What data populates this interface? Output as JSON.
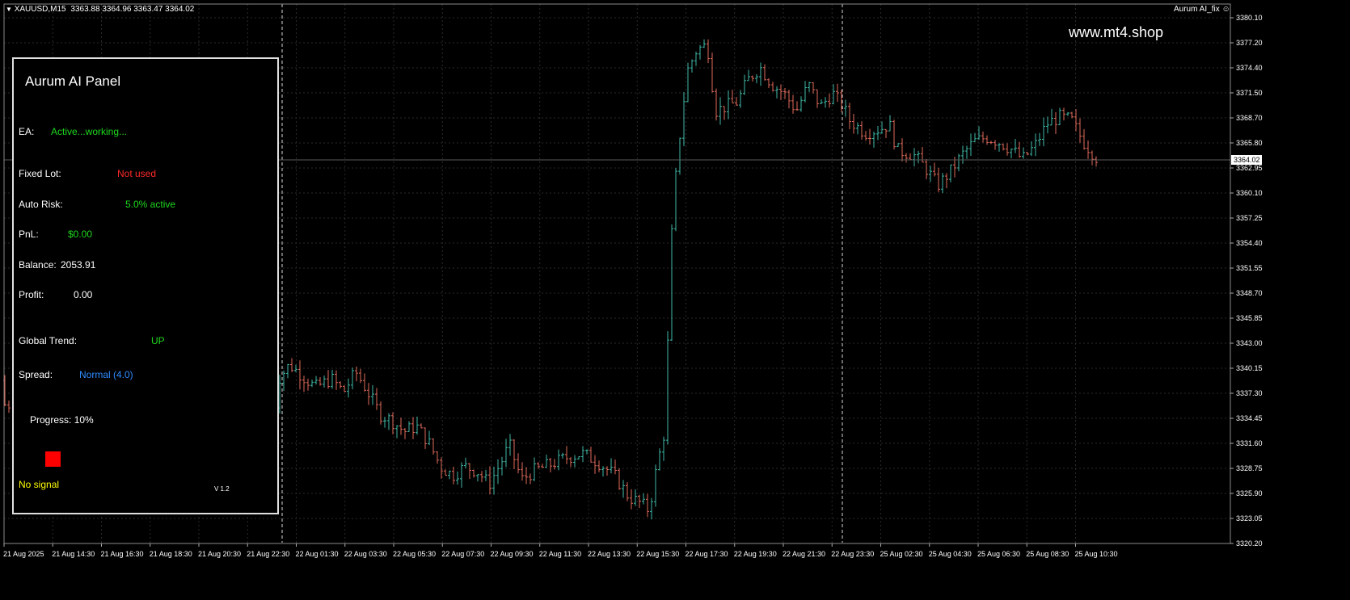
{
  "window": {
    "symbol_label": "XAUUSD,M15",
    "ohlc": "3363.88 3364.96 3363.47 3364.02",
    "indicator_label": "Aurum AI_fix",
    "watermark": "www.mt4.shop"
  },
  "panel": {
    "title": "Aurum AI Panel",
    "ea_label": "EA:",
    "ea_value": "Active...working...",
    "fixed_lot_label": "Fixed Lot:",
    "fixed_lot_value": "Not used",
    "auto_risk_label": "Auto Risk:",
    "auto_risk_value": "5.0% active",
    "pnl_label": "PnL:",
    "pnl_value": "$0.00",
    "balance_label": "Balance:",
    "balance_value": "2053.91",
    "profit_label": "Profit:",
    "profit_value": "0.00",
    "global_trend_label": "Global Trend:",
    "global_trend_value": "UP",
    "spread_label": "Spread:",
    "spread_value": "Normal (4.0)",
    "progress_label": "Progress:",
    "progress_value": "10%",
    "signal_text": "No signal",
    "version": "V 1.2",
    "colors": {
      "green": "#1ed81e",
      "red": "#ff2a2a",
      "blue": "#2f8bff",
      "yellow": "#ffff00",
      "signal_square": "#ff0000"
    }
  },
  "price_axis": {
    "current_price": "3364.02",
    "ticks": [
      "3380.10",
      "3377.20",
      "3374.40",
      "3371.50",
      "3368.70",
      "3365.80",
      "3362.95",
      "3360.10",
      "3357.25",
      "3354.40",
      "3351.55",
      "3348.70",
      "3345.85",
      "3343.00",
      "3340.15",
      "3337.30",
      "3334.45",
      "3331.60",
      "3328.75",
      "3325.90",
      "3323.05",
      "3320.20"
    ]
  },
  "time_axis": {
    "ticks": [
      "21 Aug 2025",
      "21 Aug 14:30",
      "21 Aug 16:30",
      "21 Aug 18:30",
      "21 Aug 20:30",
      "21 Aug 22:30",
      "22 Aug 01:30",
      "22 Aug 03:30",
      "22 Aug 05:30",
      "22 Aug 07:30",
      "22 Aug 09:30",
      "22 Aug 11:30",
      "22 Aug 13:30",
      "22 Aug 15:30",
      "22 Aug 17:30",
      "22 Aug 19:30",
      "22 Aug 21:30",
      "22 Aug 23:30",
      "25 Aug 02:30",
      "25 Aug 04:30",
      "25 Aug 06:30",
      "25 Aug 08:30",
      "25 Aug 10:30"
    ]
  },
  "chart_colors": {
    "background": "#000000",
    "grid": "#2a2a2a",
    "bull": "#3fb9a6",
    "bear": "#e06a5a",
    "separator": "#d8d8d8",
    "axis_text": "#ffffff"
  },
  "chart_data": {
    "type": "candlestick",
    "y_unit": "price",
    "close_path": [
      [
        0,
        3336
      ],
      [
        343,
        3338.8
      ],
      [
        358,
        3340.6
      ],
      [
        372,
        3339.5
      ],
      [
        390,
        3338.0
      ],
      [
        410,
        3339.0
      ],
      [
        425,
        3337.5
      ],
      [
        440,
        3339.8
      ],
      [
        455,
        3337.5
      ],
      [
        470,
        3335.0
      ],
      [
        485,
        3334.2
      ],
      [
        500,
        3333.0
      ],
      [
        515,
        3333.6
      ],
      [
        530,
        3331.8
      ],
      [
        545,
        3329.0
      ],
      [
        560,
        3328.0
      ],
      [
        575,
        3329.0
      ],
      [
        590,
        3328.5
      ],
      [
        605,
        3327.0
      ],
      [
        620,
        3329.5
      ],
      [
        630,
        3331.5
      ],
      [
        645,
        3327.5
      ],
      [
        660,
        3328.5
      ],
      [
        680,
        3329.2
      ],
      [
        700,
        3330.0
      ],
      [
        720,
        3330.5
      ],
      [
        740,
        3329.5
      ],
      [
        760,
        3328.0
      ],
      [
        778,
        3325.5
      ],
      [
        790,
        3325.0
      ],
      [
        803,
        3324.0
      ],
      [
        812,
        3328.8
      ],
      [
        822,
        3333.0
      ],
      [
        832,
        3358.0
      ],
      [
        840,
        3366.0
      ],
      [
        850,
        3374.0
      ],
      [
        862,
        3376.5
      ],
      [
        875,
        3377.0
      ],
      [
        885,
        3369.5
      ],
      [
        898,
        3370.0
      ],
      [
        912,
        3370.5
      ],
      [
        925,
        3373.0
      ],
      [
        940,
        3374.5
      ],
      [
        955,
        3372.5
      ],
      [
        970,
        3371.5
      ],
      [
        985,
        3369.5
      ],
      [
        1000,
        3372.5
      ],
      [
        1015,
        3370.0
      ],
      [
        1030,
        3371.5
      ],
      [
        1043,
        3370.0
      ],
      [
        1050,
        3368.5
      ],
      [
        1070,
        3367.0
      ],
      [
        1090,
        3367.5
      ],
      [
        1100,
        3368.0
      ],
      [
        1110,
        3365.0
      ],
      [
        1130,
        3364.5
      ],
      [
        1145,
        3363.0
      ],
      [
        1160,
        3361.0
      ],
      [
        1175,
        3362.5
      ],
      [
        1190,
        3364.5
      ],
      [
        1205,
        3366.0
      ],
      [
        1220,
        3366.5
      ],
      [
        1235,
        3366.0
      ],
      [
        1250,
        3365.2
      ],
      [
        1265,
        3364.0
      ],
      [
        1280,
        3365.5
      ],
      [
        1295,
        3368.0
      ],
      [
        1310,
        3368.8
      ],
      [
        1325,
        3368.5
      ],
      [
        1340,
        3366.0
      ],
      [
        1358,
        3364.02
      ]
    ]
  }
}
